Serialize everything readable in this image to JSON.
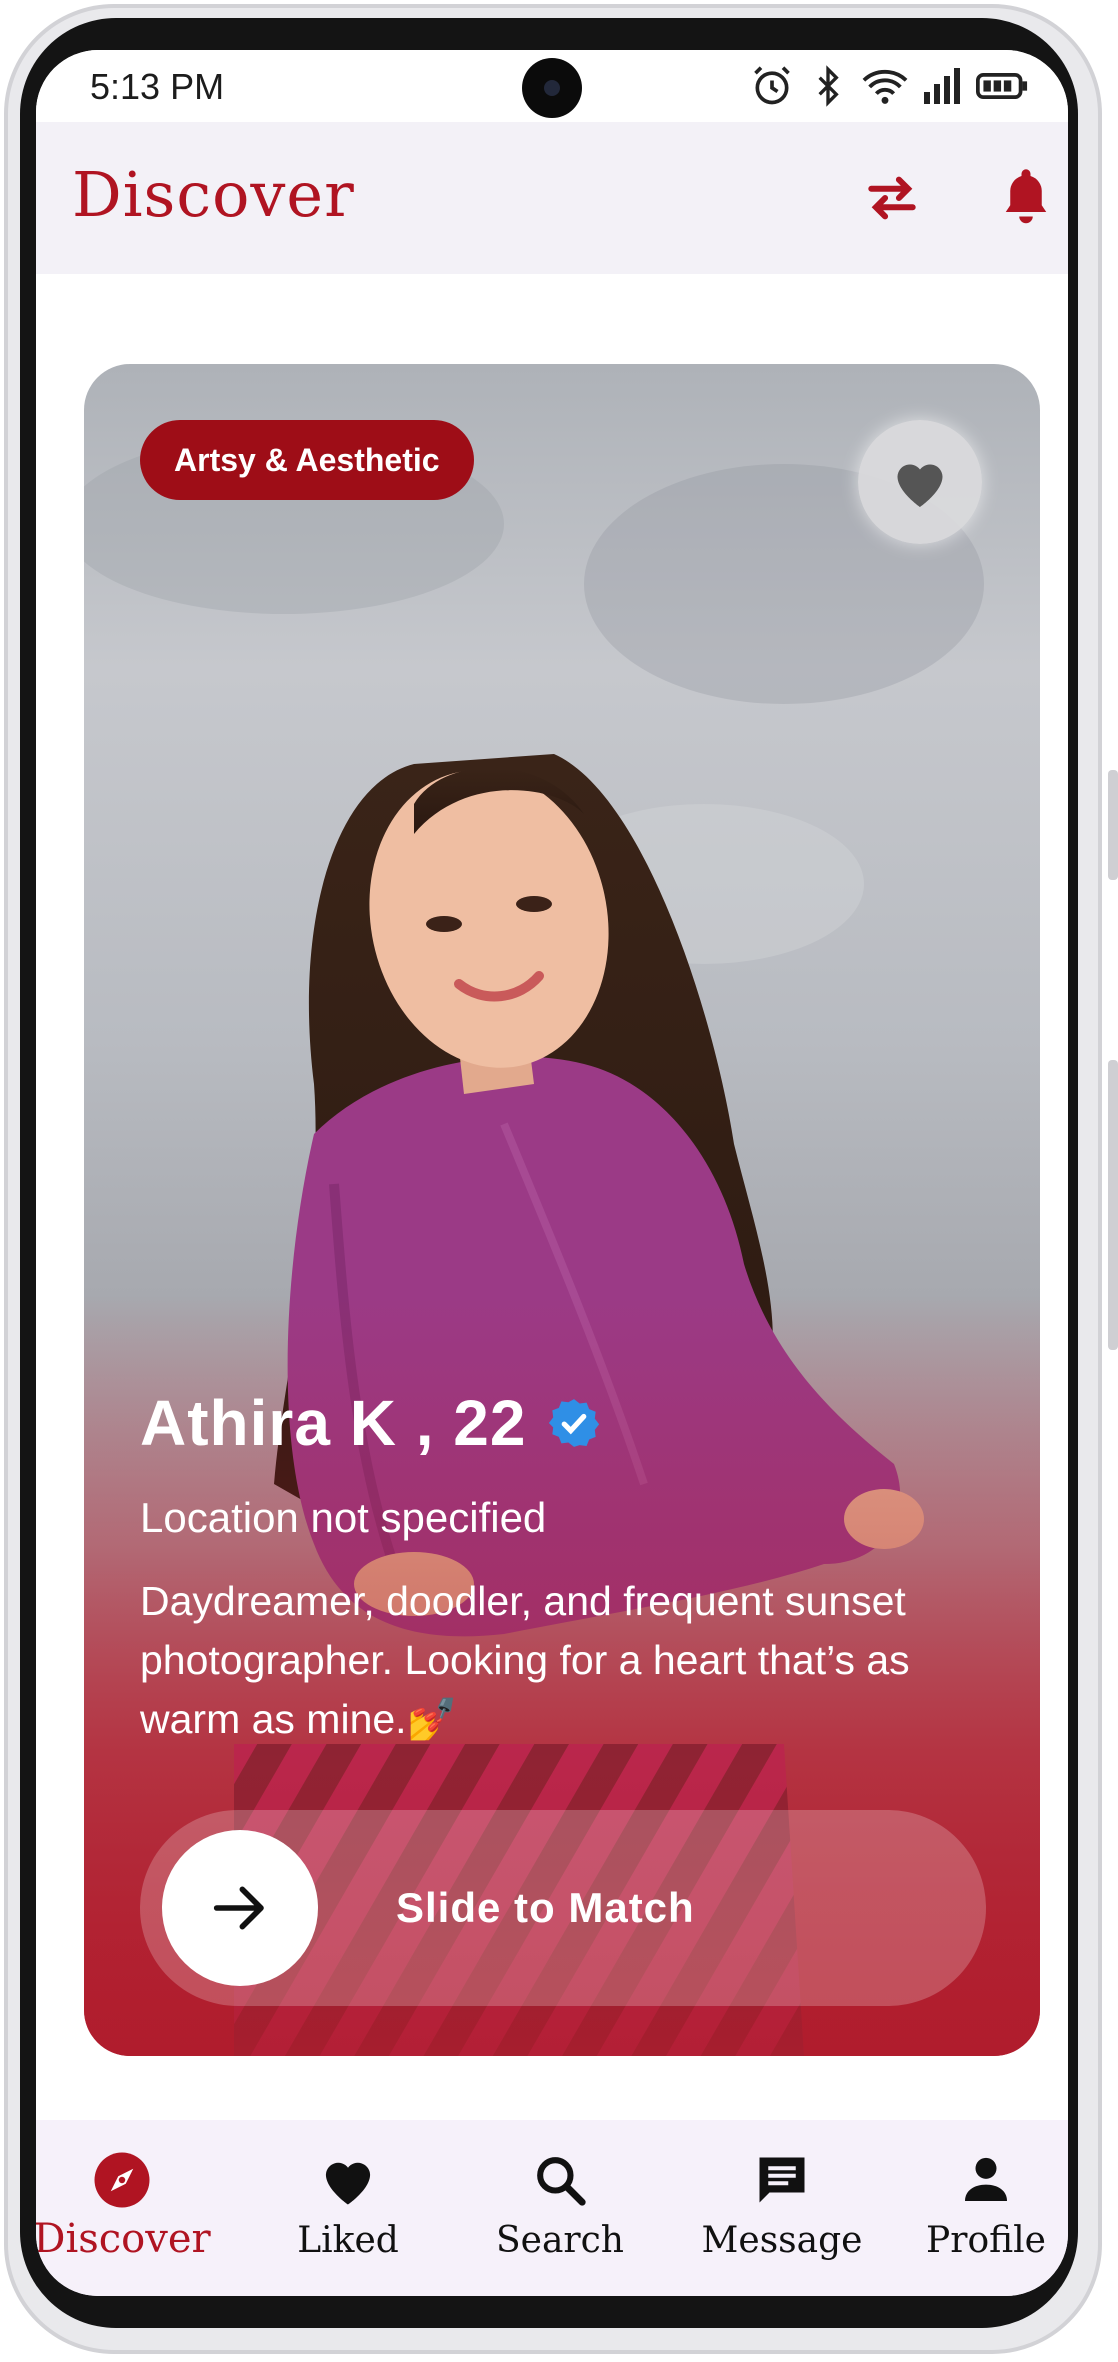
{
  "status_bar": {
    "time": "5:13 PM"
  },
  "header": {
    "title": "Discover",
    "accent_color": "#b01422"
  },
  "profile_card": {
    "interest_tag": "Artsy & Aesthetic",
    "name": "Athira K , 22",
    "verified": true,
    "location": "Location not specified",
    "bio": "Daydreamer, doodler, and frequent sunset photographer. Looking for a heart that’s as warm as mine.💅",
    "slide_label": "Slide to Match"
  },
  "bottom_nav": {
    "items": [
      {
        "label": "Discover",
        "icon": "compass-icon",
        "active": true
      },
      {
        "label": "Liked",
        "icon": "heart-icon",
        "active": false
      },
      {
        "label": "Search",
        "icon": "search-icon",
        "active": false
      },
      {
        "label": "Message",
        "icon": "message-icon",
        "active": false
      },
      {
        "label": "Profile",
        "icon": "person-icon",
        "active": false
      }
    ]
  }
}
